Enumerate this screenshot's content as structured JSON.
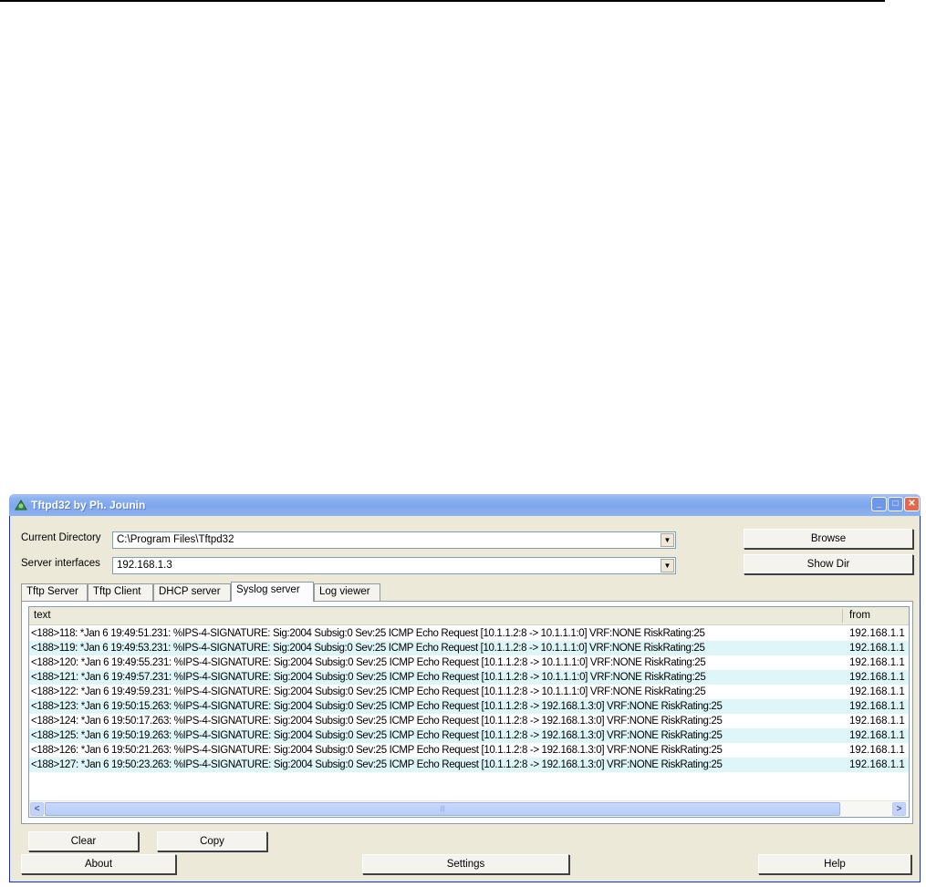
{
  "window": {
    "title": "Tftpd32 by Ph. Jounin"
  },
  "fields": {
    "current_directory_label": "Current Directory",
    "current_directory_value": "C:\\Program Files\\Tftpd32",
    "server_interfaces_label": "Server interfaces",
    "server_interfaces_value": "192.168.1.3"
  },
  "buttons": {
    "browse": "Browse",
    "show_dir": "Show Dir",
    "clear": "Clear",
    "copy": "Copy",
    "about": "About",
    "settings": "Settings",
    "help": "Help"
  },
  "tabs": [
    "Tftp Server",
    "Tftp Client",
    "DHCP server",
    "Syslog server",
    "Log viewer"
  ],
  "active_tab": "Syslog server",
  "log": {
    "columns": {
      "text": "text",
      "from": "from"
    },
    "rows": [
      {
        "text": "<188>118: *Jan  6 19:49:51.231: %IPS-4-SIGNATURE: Sig:2004 Subsig:0 Sev:25 ICMP Echo Request [10.1.1.2:8 -> 10.1.1.1:0] VRF:NONE RiskRating:25",
        "from": "192.168.1.1"
      },
      {
        "text": "<188>119: *Jan  6 19:49:53.231: %IPS-4-SIGNATURE: Sig:2004 Subsig:0 Sev:25 ICMP Echo Request [10.1.1.2:8 -> 10.1.1.1:0] VRF:NONE RiskRating:25",
        "from": "192.168.1.1"
      },
      {
        "text": "<188>120: *Jan  6 19:49:55.231: %IPS-4-SIGNATURE: Sig:2004 Subsig:0 Sev:25 ICMP Echo Request [10.1.1.2:8 -> 10.1.1.1:0] VRF:NONE RiskRating:25",
        "from": "192.168.1.1"
      },
      {
        "text": "<188>121: *Jan  6 19:49:57.231: %IPS-4-SIGNATURE: Sig:2004 Subsig:0 Sev:25 ICMP Echo Request [10.1.1.2:8 -> 10.1.1.1:0] VRF:NONE RiskRating:25",
        "from": "192.168.1.1"
      },
      {
        "text": "<188>122: *Jan  6 19:49:59.231: %IPS-4-SIGNATURE: Sig:2004 Subsig:0 Sev:25 ICMP Echo Request [10.1.1.2:8 -> 10.1.1.1:0] VRF:NONE RiskRating:25",
        "from": "192.168.1.1"
      },
      {
        "text": "<188>123: *Jan  6 19:50:15.263: %IPS-4-SIGNATURE: Sig:2004 Subsig:0 Sev:25 ICMP Echo Request [10.1.1.2:8 -> 192.168.1.3:0] VRF:NONE RiskRating:25",
        "from": "192.168.1.1"
      },
      {
        "text": "<188>124: *Jan  6 19:50:17.263: %IPS-4-SIGNATURE: Sig:2004 Subsig:0 Sev:25 ICMP Echo Request [10.1.1.2:8 -> 192.168.1.3:0] VRF:NONE RiskRating:25",
        "from": "192.168.1.1"
      },
      {
        "text": "<188>125: *Jan  6 19:50:19.263: %IPS-4-SIGNATURE: Sig:2004 Subsig:0 Sev:25 ICMP Echo Request [10.1.1.2:8 -> 192.168.1.3:0] VRF:NONE RiskRating:25",
        "from": "192.168.1.1"
      },
      {
        "text": "<188>126: *Jan  6 19:50:21.263: %IPS-4-SIGNATURE: Sig:2004 Subsig:0 Sev:25 ICMP Echo Request [10.1.1.2:8 -> 192.168.1.3:0] VRF:NONE RiskRating:25",
        "from": "192.168.1.1"
      },
      {
        "text": "<188>127: *Jan  6 19:50:23.263: %IPS-4-SIGNATURE: Sig:2004 Subsig:0 Sev:25 ICMP Echo Request [10.1.1.2:8 -> 192.168.1.3:0] VRF:NONE RiskRating:25",
        "from": "192.168.1.1"
      }
    ]
  },
  "icons": [
    "app-icon",
    "minimize-icon",
    "maximize-icon",
    "close-icon",
    "scroll-left-icon",
    "scroll-right-icon",
    "dropdown-arrow-icon"
  ],
  "colors": {
    "titlebar": "#7da6ec",
    "alt_row": "#dff6f9",
    "window_bg": "#ece9d8"
  }
}
